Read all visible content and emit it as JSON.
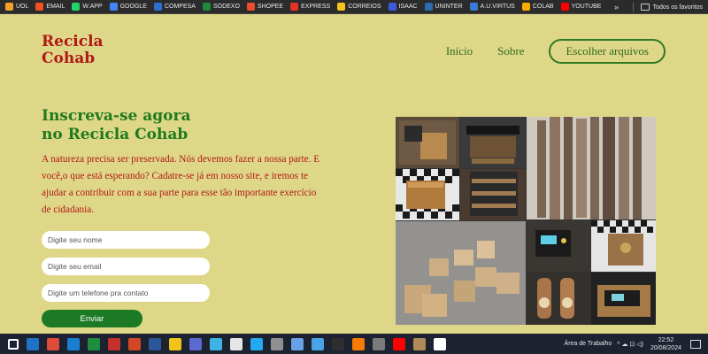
{
  "bookmarks": [
    {
      "label": "UOL",
      "icon": "uol-icon",
      "color": "#f2a22a"
    },
    {
      "label": "EMAIL",
      "icon": "microsoft-icon",
      "color": "#f25022"
    },
    {
      "label": "W.APP",
      "icon": "whatsapp-icon",
      "color": "#25d366"
    },
    {
      "label": "GOOGLE",
      "icon": "google-icon",
      "color": "#4285f4"
    },
    {
      "label": "COMPESA",
      "icon": "compesa-icon",
      "color": "#2a6fd1"
    },
    {
      "label": "SODEXO",
      "icon": "sodexo-icon",
      "color": "#1c8a3a"
    },
    {
      "label": "SHOPEE",
      "icon": "shopee-icon",
      "color": "#ee4d2d"
    },
    {
      "label": "EXPRESS",
      "icon": "aliexpress-icon",
      "color": "#e43225"
    },
    {
      "label": "CORREIOS",
      "icon": "correios-icon",
      "color": "#f5c518"
    },
    {
      "label": "ISAAC",
      "icon": "isaac-icon",
      "color": "#3b5bdb"
    },
    {
      "label": "UNINTER",
      "icon": "uninter-icon",
      "color": "#2b6cb0"
    },
    {
      "label": "A.U.VIRTUS",
      "icon": "virtus-icon",
      "color": "#3a7bd5"
    },
    {
      "label": "COLAB",
      "icon": "colab-icon",
      "color": "#f9ab00"
    },
    {
      "label": "YOUTUBE",
      "icon": "youtube-icon",
      "color": "#ff0000"
    }
  ],
  "bookmarks_overflow": "»",
  "bookmarks_folder": "Todos os favoritos",
  "site": {
    "logo_line1": "Recicla",
    "logo_line2": "Cohab",
    "nav_home": "Início",
    "nav_about": "Sobre",
    "nav_choose_files": "Escolher arquivos"
  },
  "hero": {
    "title_line1": "Inscreva-se agora",
    "title_line2": "no Recicla Cohab",
    "text": "A natureza precisa ser preservada. Nós devemos fazer a nossa parte. E você,o que está esperando? Cadatre-se já em nosso site, e iremos te ajudar a contribuir com a sua parte para esse tão importante exercício de cidadania."
  },
  "form": {
    "name_placeholder": "Digite seu nome",
    "email_placeholder": "Digite seu email",
    "phone_placeholder": "Digite um telefone pra contato",
    "submit_label": "Enviar"
  },
  "taskbar": {
    "apps": [
      "windows-start-icon",
      "outlook-icon",
      "chrome-icon",
      "edge-icon",
      "excel-icon",
      "photo-icon",
      "powerpoint-icon",
      "word-icon",
      "file-explorer-icon",
      "app-icon",
      "clipchamp-icon",
      "notepad-icon",
      "vscode-icon",
      "app-icon",
      "box-icon",
      "paint-icon",
      "terminal-icon",
      "xampp-icon",
      "app-icon",
      "youtube-icon",
      "game-icon",
      "flower-icon"
    ],
    "desktop_label": "Área de Trabalho",
    "time": "22:52",
    "date": "20/08/2024"
  },
  "colors": {
    "page_bg": "#dfd788",
    "brand_red": "#b01818",
    "brand_green": "#1f7a1f",
    "button_green": "#1b7a23"
  }
}
